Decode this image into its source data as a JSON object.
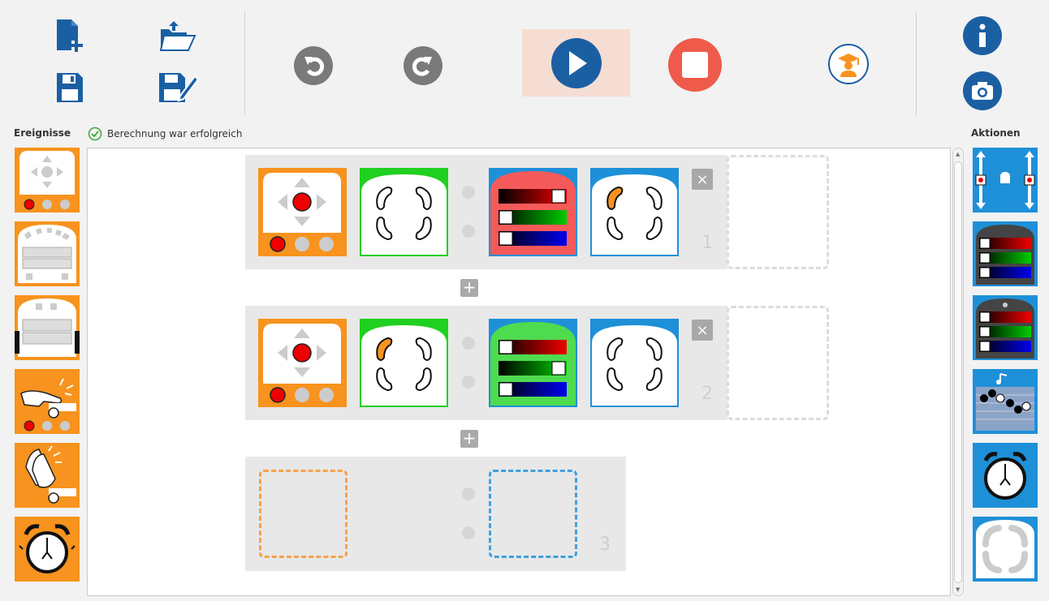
{
  "toolbar": {
    "buttons": [
      {
        "name": "new-file",
        "icon": "new-file-icon"
      },
      {
        "name": "save",
        "icon": "save-icon"
      },
      {
        "name": "open",
        "icon": "open-folder-icon"
      },
      {
        "name": "save-as",
        "icon": "save-as-icon"
      },
      {
        "name": "undo",
        "icon": "undo-icon"
      },
      {
        "name": "redo",
        "icon": "redo-icon"
      },
      {
        "name": "run",
        "icon": "play-icon"
      },
      {
        "name": "stop",
        "icon": "stop-icon"
      },
      {
        "name": "teacher",
        "icon": "graduate-icon"
      },
      {
        "name": "info",
        "icon": "info-icon"
      },
      {
        "name": "screenshot",
        "icon": "camera-icon"
      }
    ]
  },
  "left_palette": {
    "label": "Ereignisse"
  },
  "right_palette": {
    "label": "Aktionen"
  },
  "status": {
    "text": "Berechnung war erfolgreich",
    "icon": "check-circle-icon"
  },
  "pairs": [
    {
      "number": "1"
    },
    {
      "number": "2"
    },
    {
      "number": "3"
    }
  ],
  "colors": {
    "event": "#f7931e",
    "action": "#1e90d8",
    "play": "#1b5fa3",
    "stop": "#ef5b4a",
    "toolbar_icon": "#1b5fa3",
    "top_color_red": "#f45a5a",
    "top_color_green": "#4fdb4f",
    "highlight_green": "#20d020"
  }
}
